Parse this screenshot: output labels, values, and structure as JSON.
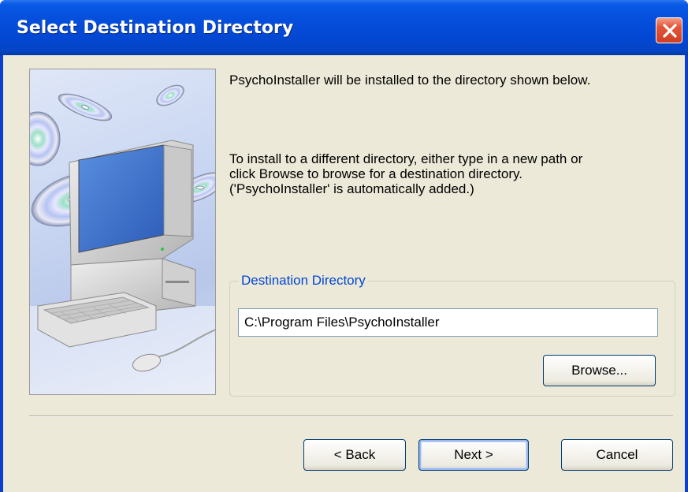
{
  "window": {
    "title": "Select Destination Directory",
    "close_icon": "close-x-icon"
  },
  "sidebar": {
    "image_description_icon": "computer-with-cds-illustration"
  },
  "content": {
    "intro_text": "PsychoInstaller will be installed to the directory shown below.",
    "instructions_text": "To install to a different directory, either type in a new path or\nclick Browse to browse for a destination directory.\n('PsychoInstaller' is automatically added.)"
  },
  "destination_group": {
    "legend": "Destination Directory",
    "path_value": "C:\\Program Files\\PsychoInstaller",
    "browse_label": "Browse..."
  },
  "footer": {
    "back_label": "< Back",
    "next_label": "Next >",
    "cancel_label": "Cancel"
  },
  "colors": {
    "titlebar": "#0550dd",
    "client_background": "#ece9d8",
    "group_legend": "#0046d5",
    "close_button": "#e2573a"
  }
}
